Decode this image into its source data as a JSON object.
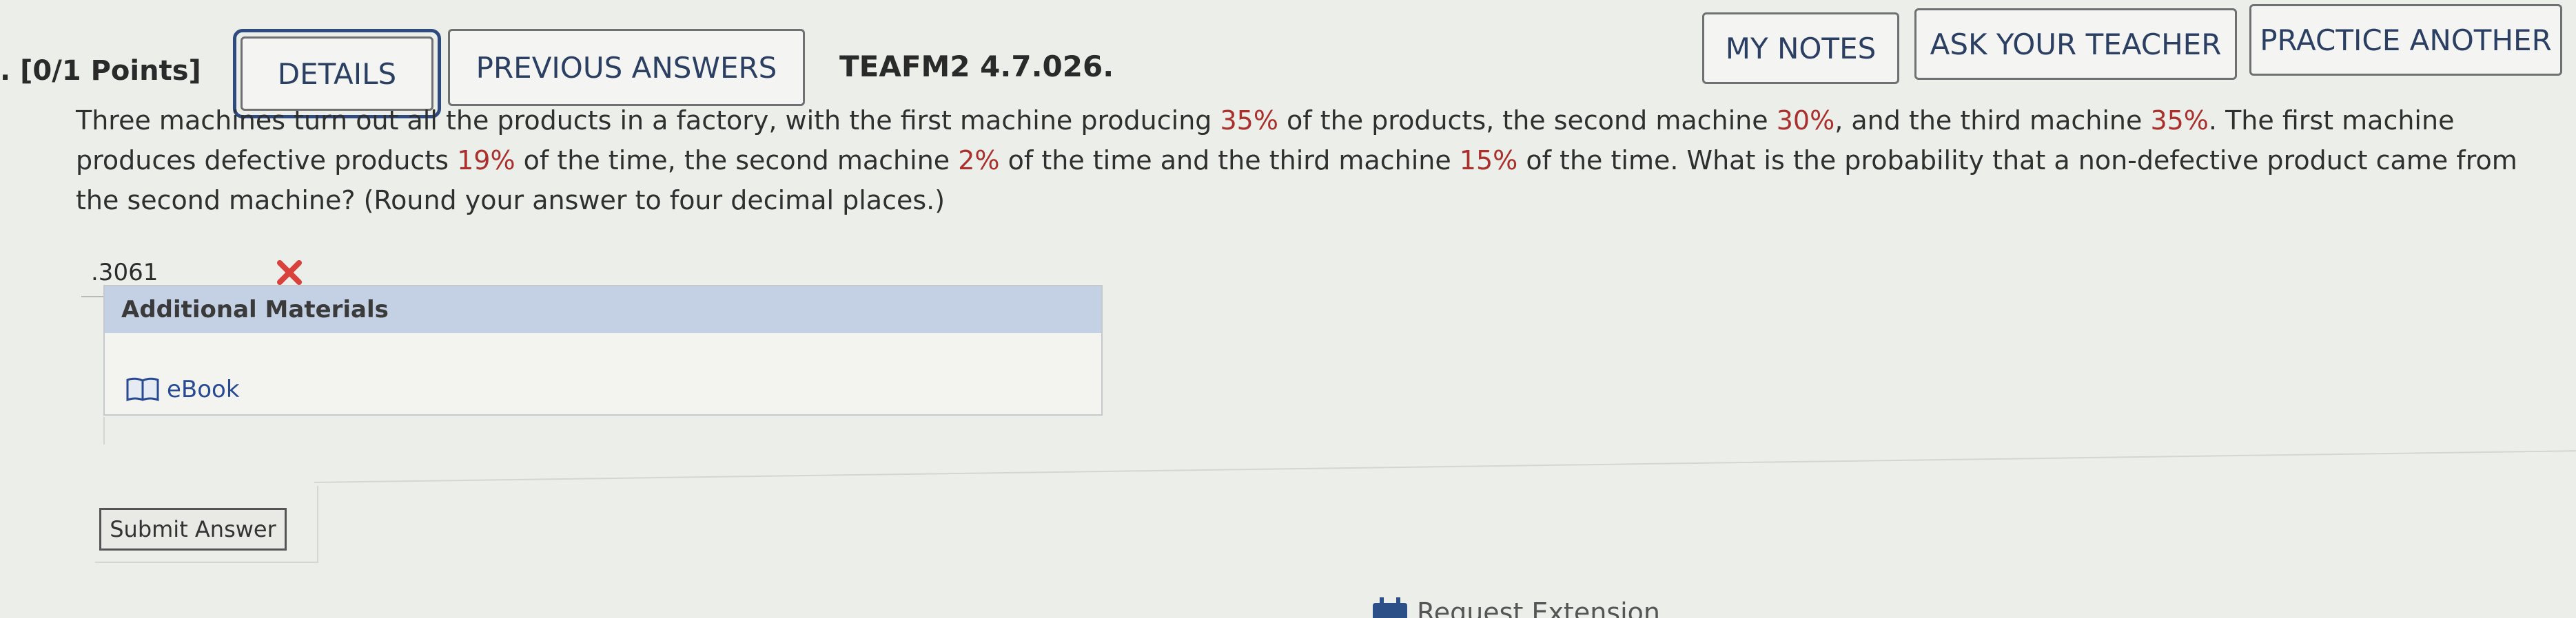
{
  "header": {
    "points": ". [0/1 Points]",
    "details_label": "DETAILS",
    "previous_answers_label": "PREVIOUS ANSWERS",
    "question_id": "TEAFM2 4.7.026.",
    "my_notes_label": "MY NOTES",
    "ask_teacher_label": "ASK YOUR TEACHER",
    "practice_another_label": "PRACTICE ANOTHER"
  },
  "question": {
    "t1": "Three machines turn out all the products in a factory, with the first machine producing ",
    "p1": "35%",
    "t2": " of the products, the second machine ",
    "p2": "30%",
    "t3": ", and the third machine ",
    "p3": "35%",
    "t4": ". The first machine produces defective products ",
    "p4": "19%",
    "t5": " of the time, the second machine ",
    "p5": "2%",
    "t6": " of the time and the third machine ",
    "p6": "15%",
    "t7": " of the time. What is the probability that a non-defective product came from the second machine? (Round your answer to four decimal places.)",
    "highlight_color": "#a9302c"
  },
  "answer": {
    "value": ".3061",
    "status_icon": "wrong-x-icon",
    "status_color": "#d9423c"
  },
  "materials": {
    "header": "Additional Materials",
    "ebook_label": "eBook",
    "ebook_icon": "book-icon"
  },
  "submit": {
    "label": "Submit Answer"
  },
  "extension": {
    "label": "Request Extension",
    "icon": "calendar-icon"
  }
}
